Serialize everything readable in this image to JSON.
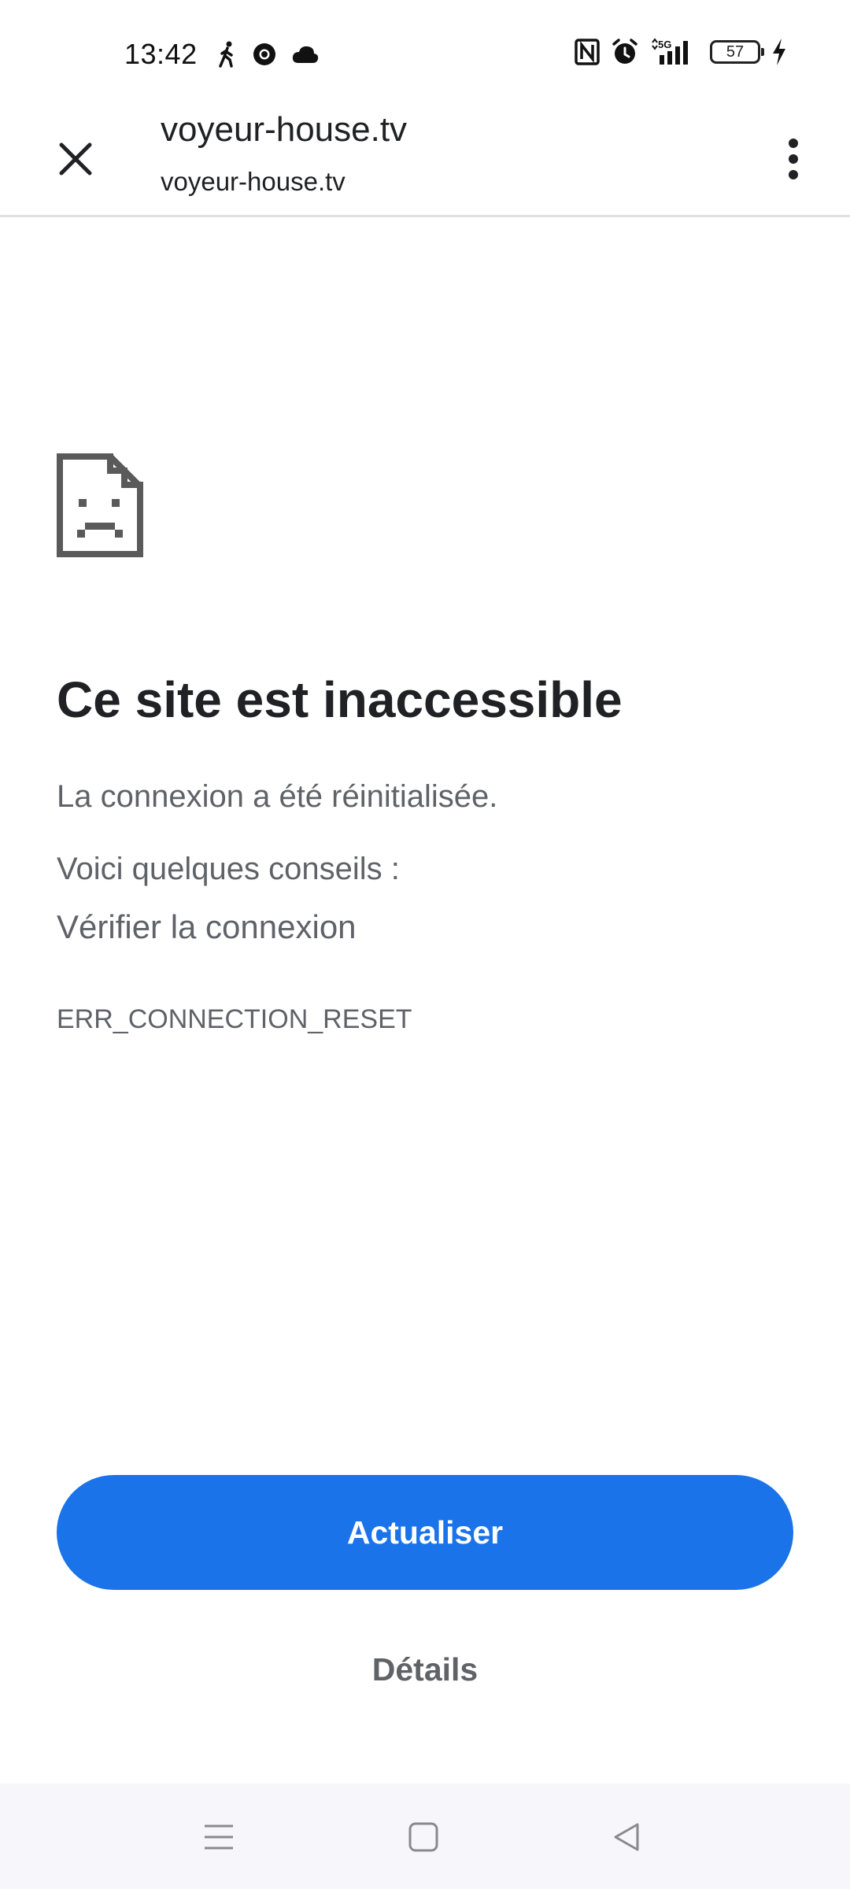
{
  "status_bar": {
    "time": "13:42",
    "battery_level": "57",
    "network": "5G",
    "left_icons": [
      "walking-person-icon",
      "chrome-icon",
      "cloud-icon"
    ],
    "right_icons": [
      "nfc-icon",
      "alarm-icon",
      "signal-5g-icon",
      "battery-icon",
      "charging-icon"
    ]
  },
  "toolbar": {
    "title": "voyeur-house.tv",
    "url": "voyeur-house.tv",
    "close_icon": "close-icon",
    "menu_icon": "more-vert-icon"
  },
  "error": {
    "icon": "sad-page-icon",
    "title": "Ce site est inaccessible",
    "description": "La connexion a été réinitialisée.",
    "tips_heading": "Voici quelques conseils :",
    "tips": [
      "Vérifier la connexion"
    ],
    "code": "ERR_CONNECTION_RESET"
  },
  "actions": {
    "reload_label": "Actualiser",
    "details_label": "Détails"
  },
  "nav_bar": {
    "buttons": [
      "menu-icon",
      "home-icon",
      "back-icon"
    ]
  },
  "colors": {
    "accent": "#1a73e8",
    "text_primary": "#202124",
    "text_secondary": "#5f6368",
    "nav_background": "#f7f7fb"
  }
}
